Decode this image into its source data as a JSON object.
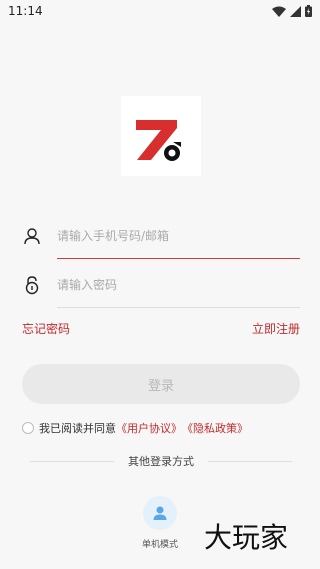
{
  "status_bar": {
    "time": "11:14",
    "icons": [
      "wifi-icon",
      "signal-icon",
      "battery-icon"
    ]
  },
  "logo": {
    "text": "Z",
    "colors": {
      "accent": "#d82e2e",
      "dark": "#111111"
    }
  },
  "form": {
    "username_placeholder": "请输入手机号码/邮箱",
    "username_value": "",
    "password_placeholder": "请输入密码",
    "password_value": ""
  },
  "links": {
    "forgot_password": "忘记密码",
    "register": "立即注册"
  },
  "login_button": "登录",
  "agreement": {
    "prefix": "我已阅读并同意",
    "user_agreement": "《用户协议》",
    "privacy_policy": "《隐私政策》",
    "checked": false
  },
  "other_login": {
    "title": "其他登录方式",
    "single_mode": "单机模式"
  },
  "watermark": "大玩家",
  "colors": {
    "accent": "#c22c2c",
    "button_bg": "#e9e9e9",
    "button_text": "#b8b8b8",
    "background": "#f7f7f7"
  }
}
